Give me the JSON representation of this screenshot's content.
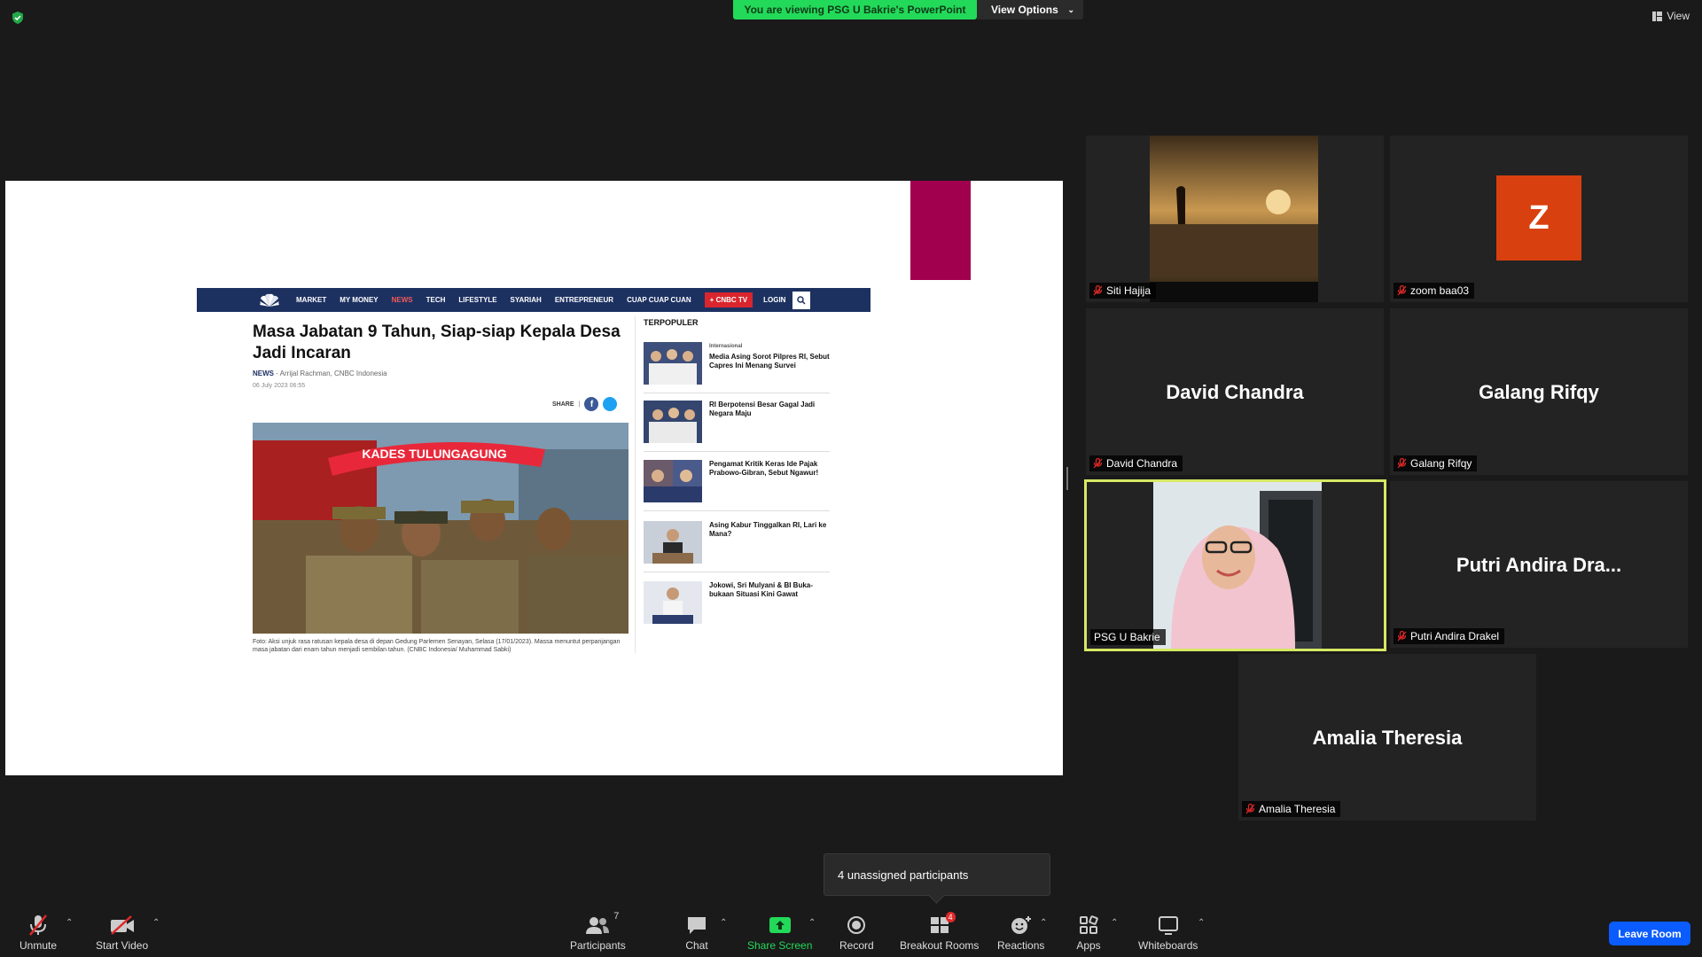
{
  "top": {
    "viewing_banner": "You are viewing PSG U Bakrie's PowerPoint",
    "view_options": "View Options",
    "view": "View",
    "security_icon": "shield-check-icon"
  },
  "slide": {
    "nav": [
      "MARKET",
      "MY MONEY",
      "NEWS",
      "TECH",
      "LIFESTYLE",
      "SYARIAH",
      "ENTREPRENEUR",
      "CUAP CUAP CUAN"
    ],
    "nav_active": "NEWS",
    "nav_tv": "+ CNBC TV",
    "nav_login": "LOGIN",
    "title": "Masa Jabatan 9 Tahun, Siap-siap Kepala Desa Jadi Incaran",
    "byline_section": "NEWS",
    "byline_author": " - Arrijal Rachman, CNBC Indonesia",
    "date": "06 July 2023 06:55",
    "share_label": "SHARE",
    "photo_text": "KADES TULUNGAGUNG",
    "caption": "Foto: Aksi unjuk rasa ratusan kepala desa di depan Gedung Parlemen Senayan, Selasa (17/01/2023). Massa menuntut perpanjangan masa jabatan dari enam tahun menjadi sembilan tahun. (CNBC Indonesia/ Muhammad Sabki)",
    "popular_heading": "TERPOPULER",
    "popular": [
      {
        "category": "Internasional",
        "title": "Media Asing Sorot Pilpres RI, Sebut Capres Ini Menang Survei"
      },
      {
        "category": "",
        "title": "RI Berpotensi Besar Gagal Jadi Negara Maju"
      },
      {
        "category": "",
        "title": "Pengamat Kritik Keras Ide Pajak Prabowo-Gibran, Sebut Ngawur!"
      },
      {
        "category": "",
        "title": "Asing Kabur Tinggalkan RI, Lari ke Mana?"
      },
      {
        "category": "",
        "title": "Jokowi, Sri Mulyani & BI Buka-bukaan Situasi Kini Gawat"
      }
    ]
  },
  "participants": [
    {
      "name": "Siti Hajija",
      "display": "",
      "type": "video-sunset"
    },
    {
      "name": "zoom baa03",
      "display": "",
      "type": "avatar",
      "avatar_letter": "Z"
    },
    {
      "name": "David Chandra",
      "display": "David Chandra",
      "type": "name"
    },
    {
      "name": "Galang Rifqy",
      "display": "Galang Rifqy",
      "type": "name"
    },
    {
      "name": "PSG U Bakrie",
      "display": "",
      "type": "video-woman",
      "active": true
    },
    {
      "name": "Putri Andira Drakel",
      "display": "Putri Andira Dra...",
      "type": "name"
    },
    {
      "name": "Amalia Theresia",
      "display": "Amalia Theresia",
      "type": "name"
    }
  ],
  "tooltip": "4 unassigned participants",
  "toolbar": {
    "unmute": "Unmute",
    "start_video": "Start Video",
    "participants": "Participants",
    "participants_count": "7",
    "chat": "Chat",
    "share_screen": "Share Screen",
    "record": "Record",
    "breakout_rooms": "Breakout Rooms",
    "breakout_badge": "4",
    "reactions": "Reactions",
    "apps": "Apps",
    "whiteboards": "Whiteboards",
    "leave": "Leave Room"
  },
  "colors": {
    "banner_green": "#23d959",
    "active_border": "#d6e864",
    "leave_blue": "#0b5cff",
    "zoom_avatar": "#d9400f",
    "cnbc_navy": "#1d3161"
  }
}
